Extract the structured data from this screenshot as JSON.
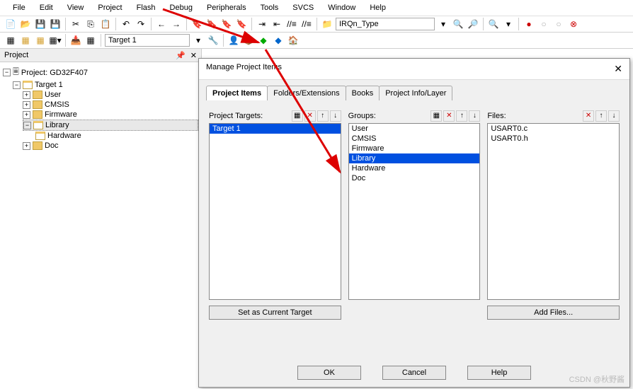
{
  "menu": [
    "File",
    "Edit",
    "View",
    "Project",
    "Flash",
    "Debug",
    "Peripherals",
    "Tools",
    "SVCS",
    "Window",
    "Help"
  ],
  "toolbar": {
    "target": "Target 1",
    "combo": "IRQn_Type"
  },
  "project": {
    "title": "Project",
    "root": "Project: GD32F407",
    "target": "Target 1",
    "folders": [
      "User",
      "CMSIS",
      "Firmware",
      "Library",
      "Hardware",
      "Doc"
    ],
    "selected": "Library"
  },
  "dialog": {
    "title": "Manage Project Items",
    "tabs": [
      "Project Items",
      "Folders/Extensions",
      "Books",
      "Project Info/Layer"
    ],
    "targets_label": "Project Targets:",
    "groups_label": "Groups:",
    "files_label": "Files:",
    "targets": [
      "Target 1"
    ],
    "groups": [
      "User",
      "CMSIS",
      "Firmware",
      "Library",
      "Hardware",
      "Doc"
    ],
    "groups_selected": "Library",
    "files": [
      "USART0.c",
      "USART0.h"
    ],
    "set_target": "Set as Current Target",
    "add_files": "Add Files...",
    "ok": "OK",
    "cancel": "Cancel",
    "help": "Help"
  },
  "watermark": "CSDN @秋野酱"
}
